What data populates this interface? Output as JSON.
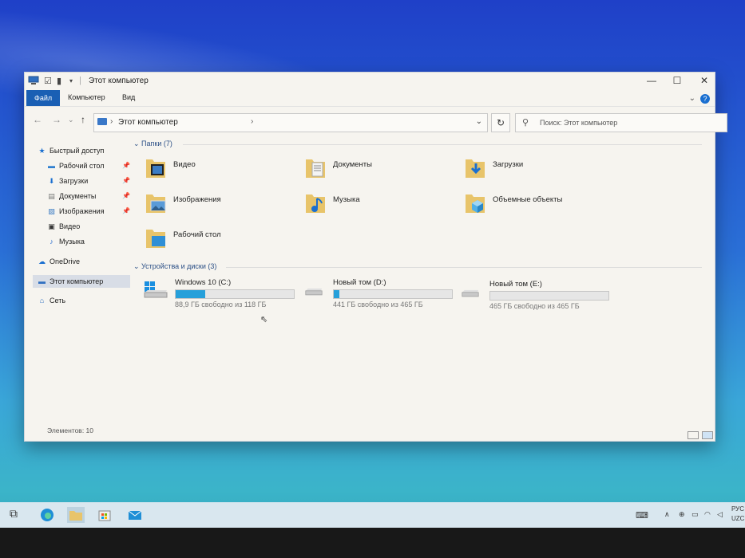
{
  "window": {
    "title": "Этот компьютер",
    "controls": {
      "minimize": "—",
      "maximize": "☐",
      "close": "✕"
    }
  },
  "ribbon": {
    "tabs": [
      "Файл",
      "Компьютер",
      "Вид"
    ],
    "help_icon": "?"
  },
  "address_bar": {
    "path": "Этот компьютер",
    "search_placeholder": "Поиск: Этот компьютер"
  },
  "sidebar": {
    "quick_access": "Быстрый доступ",
    "items": [
      {
        "label": "Рабочий стол",
        "icon": "desktop-icon",
        "pinned": true
      },
      {
        "label": "Загрузки",
        "icon": "downloads-icon",
        "pinned": true
      },
      {
        "label": "Документы",
        "icon": "documents-icon",
        "pinned": true
      },
      {
        "label": "Изображения",
        "icon": "pictures-icon",
        "pinned": true
      },
      {
        "label": "Видео",
        "icon": "video-icon",
        "pinned": false
      },
      {
        "label": "Музыка",
        "icon": "music-icon",
        "pinned": false
      }
    ],
    "onedrive": "OneDrive",
    "this_pc": "Этот компьютер",
    "network": "Сеть"
  },
  "folders_group": {
    "header": "Папки (7)",
    "items": [
      {
        "label": "Видео",
        "icon": "video-folder-icon"
      },
      {
        "label": "Документы",
        "icon": "documents-folder-icon"
      },
      {
        "label": "Загрузки",
        "icon": "downloads-folder-icon"
      },
      {
        "label": "Изображения",
        "icon": "pictures-folder-icon"
      },
      {
        "label": "Музыка",
        "icon": "music-folder-icon"
      },
      {
        "label": "Объемные объекты",
        "icon": "3d-objects-folder-icon"
      },
      {
        "label": "Рабочий стол",
        "icon": "desktop-folder-icon"
      }
    ]
  },
  "drives_group": {
    "header": "Устройства и диски (3)",
    "items": [
      {
        "label": "Windows 10 (C:)",
        "free_text": "88,9 ГБ свободно из 118 ГБ",
        "used_fraction": 0.25
      },
      {
        "label": "Новый том (D:)",
        "free_text": "441 ГБ свободно из 465 ГБ",
        "used_fraction": 0.05
      },
      {
        "label": "Новый том (E:)",
        "free_text": "465 ГБ свободно из 465 ГБ",
        "used_fraction": 0.0
      }
    ]
  },
  "status_bar": {
    "items_count": "Элементов: 10"
  },
  "colors": {
    "drive_bar_fill": "#26a0da",
    "ribbon_file_tab": "#1a5fb4",
    "folder_yellow": "#e8c46a"
  },
  "taskbar": {
    "tray_lang_1": "РУС",
    "tray_lang_2": "UZC"
  }
}
